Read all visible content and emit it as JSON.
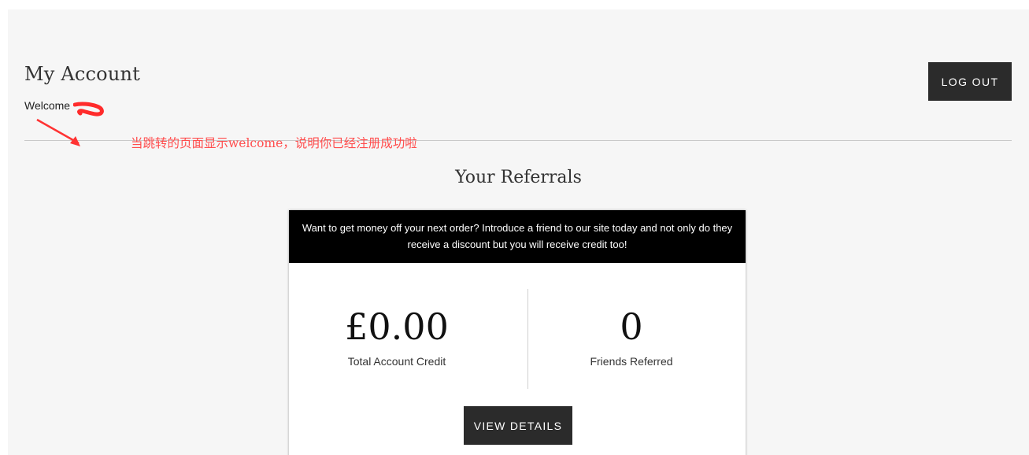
{
  "account": {
    "title": "My Account",
    "welcome": "Welcome",
    "logout_label": "LOG OUT"
  },
  "annotation": {
    "text": "当跳转的页面显示welcome，说明你已经注册成功啦",
    "color": "#ff4d4d"
  },
  "referrals": {
    "title": "Your Referrals",
    "promo_text": "Want to get money off your next order? Introduce a friend to our site today and not only do they receive a discount but you will receive credit too!",
    "credit": {
      "value": "£0.00",
      "label": "Total Account Credit"
    },
    "friends": {
      "value": "0",
      "label": "Friends Referred"
    },
    "details_label": "VIEW DETAILS"
  },
  "colors": {
    "background": "#f6f6f6",
    "button": "#2b2b2b",
    "promo_bar": "#000000"
  }
}
